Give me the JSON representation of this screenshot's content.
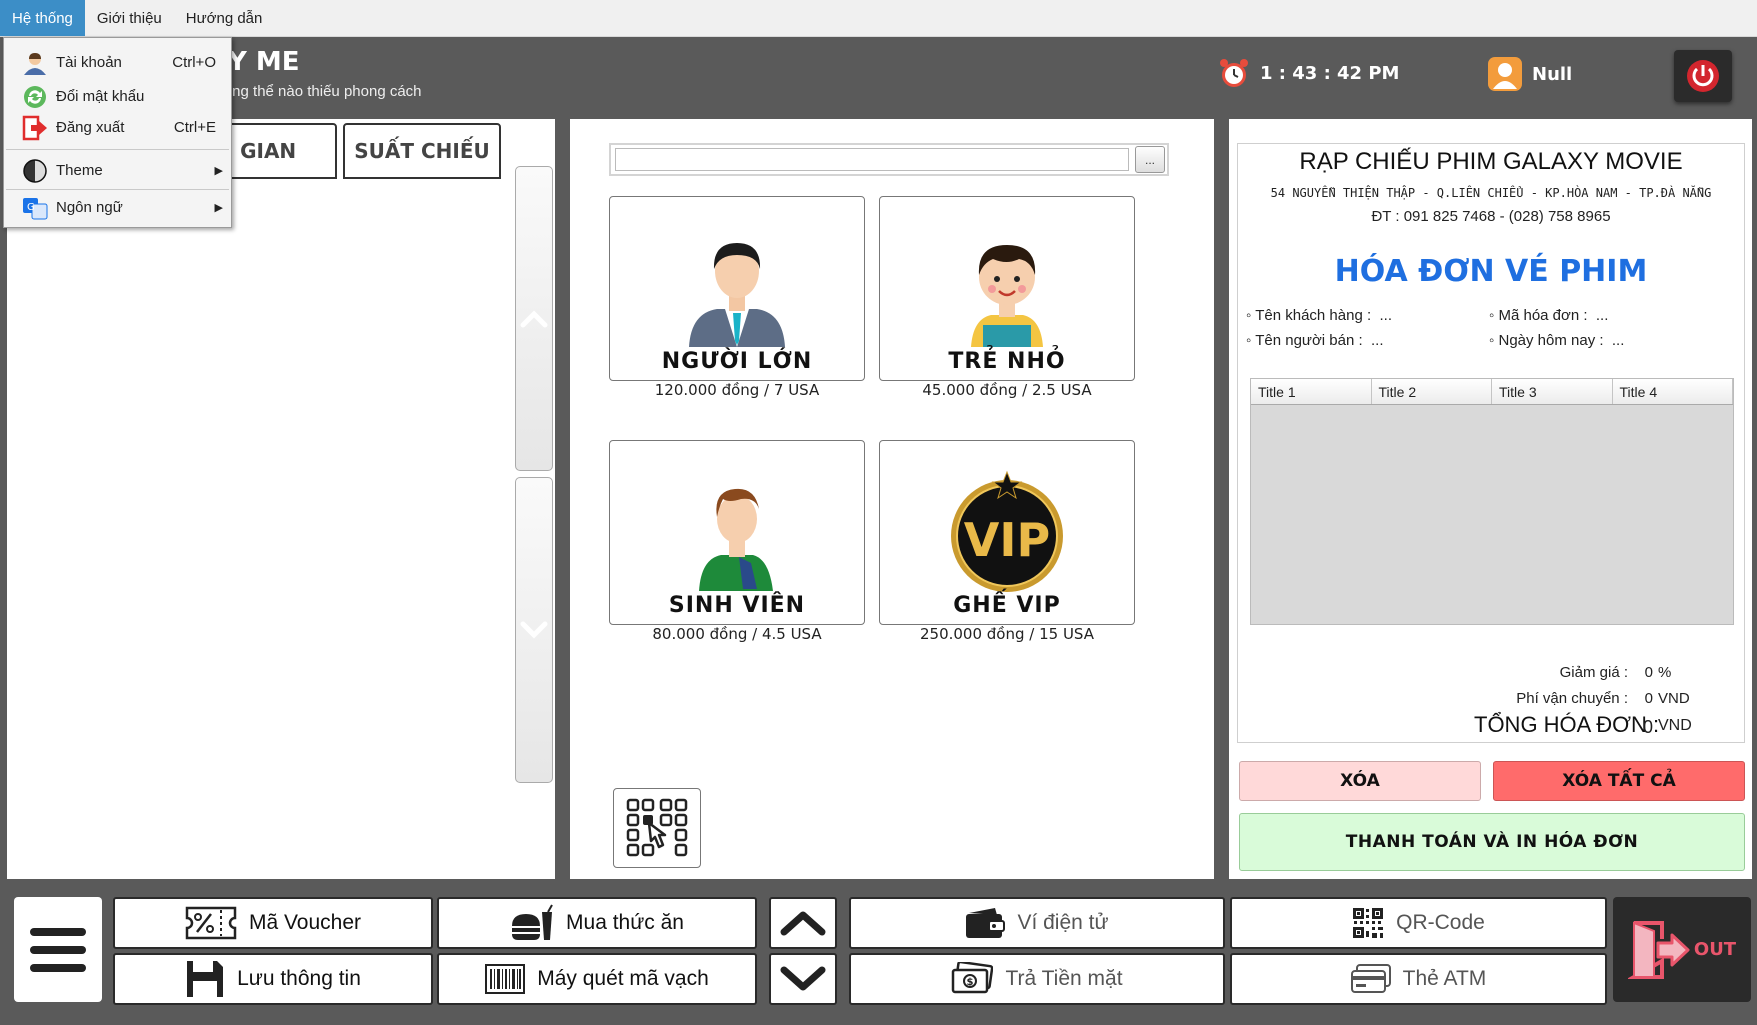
{
  "menubar": {
    "items": [
      {
        "label": "Hệ thống"
      },
      {
        "label": "Giới thiệu"
      },
      {
        "label": "Hướng dẫn"
      }
    ]
  },
  "dropdown": {
    "items": [
      {
        "label": "Tài khoản",
        "shortcut": "Ctrl+O",
        "icon": "user-account-icon"
      },
      {
        "label": "Đổi mật khẩu",
        "shortcut": "",
        "icon": "change-password-icon"
      },
      {
        "label": "Đăng xuất",
        "shortcut": "Ctrl+E",
        "icon": "logout-icon"
      },
      {
        "label": "Theme",
        "icon": "theme-icon"
      },
      {
        "label": "Ngôn ngữ",
        "icon": "language-icon"
      }
    ]
  },
  "header": {
    "brand_partial": "XY ME",
    "slogan_partial": "không thể nào thiếu phong cách",
    "time": "1 : 43 : 42 PM",
    "user": "Null"
  },
  "left": {
    "tabs": [
      {
        "label": "THỜI GIAN"
      },
      {
        "label": "SUẤT CHIẾU"
      }
    ]
  },
  "center": {
    "search": {
      "value": "",
      "button_label": "..."
    },
    "tickets": [
      {
        "title": "NGƯỜI LỚN",
        "price": "120.000 đồng / 7 USA",
        "icon": "adult-avatar-icon"
      },
      {
        "title": "TRẺ NHỎ",
        "price": "45.000 đồng / 2.5 USA",
        "icon": "child-avatar-icon"
      },
      {
        "title": "SINH VIÊN",
        "price": "80.000 đồng / 4.5 USA",
        "icon": "student-avatar-icon"
      },
      {
        "title": "GHẾ VIP",
        "price": "250.000 đồng / 15 USA",
        "icon": "vip-badge-icon"
      }
    ]
  },
  "invoice": {
    "cinema": "RẠP CHIẾU PHIM GALAXY MOVIE",
    "address": "54 NGUYỄN THIỆN THẬP - Q.LIÊN CHIỂU - KP.HÒA NAM - TP.ĐÀ NẴNG",
    "phone": "ĐT : 091 825 7468 - (028) 758 8965",
    "heading": "HÓA ĐƠN VÉ PHIM",
    "customer_label": "◦ Tên khách hàng :",
    "customer_value": "...",
    "invoice_no_label": "◦ Mã hóa đơn :",
    "invoice_no_value": "...",
    "seller_label": "◦ Tên người bán :",
    "seller_value": "...",
    "date_label": "◦ Ngày hôm nay :",
    "date_value": "...",
    "columns": [
      "Title 1",
      "Title 2",
      "Title 3",
      "Title 4"
    ],
    "discount_label": "Giảm giá :",
    "discount_value": "0",
    "discount_unit": "%",
    "shipping_label": "Phí vận chuyển :",
    "shipping_value": "0",
    "shipping_unit": "VND",
    "total_label": "TỔNG HÓA ĐƠN :",
    "total_value": "0",
    "total_unit": "VND",
    "btn_delete": "XÓA",
    "btn_delete_all": "XÓA TẤT CẢ",
    "btn_pay": "THANH TOÁN VÀ IN HÓA ĐƠN"
  },
  "bottom": {
    "voucher": "Mã Voucher",
    "food": "Mua thức ăn",
    "save": "Lưu thông tin",
    "barcode": "Máy quét mã vạch",
    "wallet": "Ví điện tử",
    "qrcode": "QR-Code",
    "cash": "Trả Tiền mặt",
    "atm": "Thẻ ATM",
    "out": "OUT"
  },
  "colors": {
    "menu_active": "#3c8ec7",
    "invoice_heading": "#1f6fe0",
    "delete_bg": "#ffd9d9",
    "delete_all_bg": "#ff6b6b",
    "pay_bg": "#d9fbd9",
    "out_accent": "#e8556b"
  }
}
